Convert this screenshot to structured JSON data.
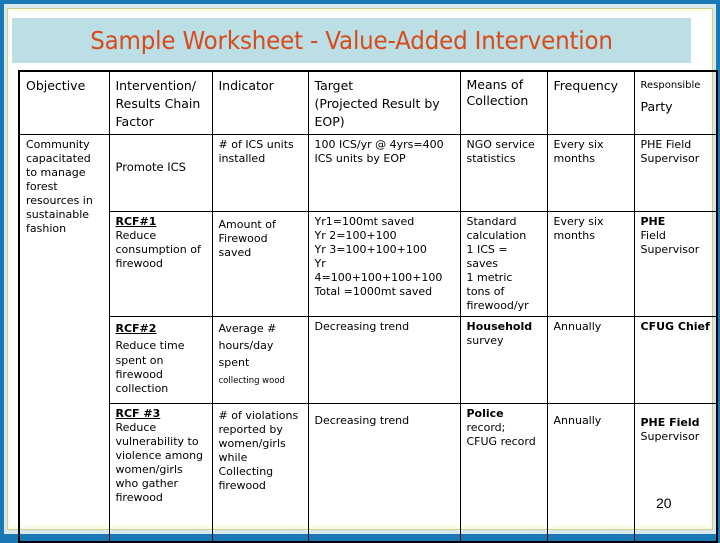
{
  "title": "Sample Worksheet - Value-Added Intervention",
  "columns": {
    "objective": "Objective",
    "intervention_l1": "Intervention/",
    "intervention_l2": "Results Chain",
    "intervention_l3": "Factor",
    "indicator": "Indicator",
    "target_l1": "Target",
    "target_l2": "(Projected Result  by",
    "target_l3": "EOP)",
    "means_l1": "Means of",
    "means_l2": "Collection",
    "frequency": "Frequency",
    "responsible_l1": "Responsible",
    "responsible_l2": "Party"
  },
  "objective": {
    "lines": [
      "Community",
      "capacitated",
      "to manage",
      "forest",
      "resources in",
      "sustainable",
      "fashion"
    ]
  },
  "rows": [
    {
      "intervention_title": "",
      "intervention": "Promote ICS",
      "indicator": [
        "# of ICS units",
        "installed"
      ],
      "target": [
        "100 ICS/yr @ 4yrs=400",
        "ICS units by EOP"
      ],
      "means": [
        "NGO service",
        "statistics"
      ],
      "frequency": [
        "Every six",
        "months"
      ],
      "responsible": [
        "PHE Field",
        "Supervisor"
      ]
    },
    {
      "intervention_title": "RCF#1",
      "intervention": [
        "Reduce",
        "consumption of",
        "firewood"
      ],
      "indicator": [
        "Amount of",
        "Firewood",
        "saved"
      ],
      "target": [
        "Yr1=100mt saved",
        "Yr 2=100+100",
        "Yr 3=100+100+100",
        "Yr 4=100+100+100+100",
        "Total =1000mt saved"
      ],
      "means": [
        "Standard",
        "calculation",
        "1 ICS = saves",
        "1 metric",
        "tons of",
        "firewood/yr"
      ],
      "frequency": [
        "Every six",
        "months"
      ],
      "responsible": [
        "PHE",
        "Field",
        "Supervisor"
      ]
    },
    {
      "intervention_title": "RCF#2",
      "intervention": [
        "Reduce time",
        "spent on",
        "firewood",
        "collection"
      ],
      "indicator": [
        "Average #",
        "hours/day",
        "spent"
      ],
      "indicator_note": "collecting wood",
      "target": "Decreasing trend",
      "means": [
        "Household",
        "survey"
      ],
      "frequency": "Annually",
      "responsible": "CFUG Chief"
    },
    {
      "intervention_title": "RCF #3",
      "intervention": [
        "Reduce",
        "vulnerability to",
        "violence among",
        "women/girls",
        "who gather",
        "firewood"
      ],
      "indicator": [
        "# of violations",
        "reported by",
        "women/girls",
        "while",
        "Collecting",
        "firewood"
      ],
      "target": "Decreasing trend",
      "means": [
        "Police",
        "record;",
        "CFUG record"
      ],
      "frequency": "Annually",
      "responsible": [
        "PHE Field",
        "Supervisor"
      ]
    }
  ],
  "page_number": "20"
}
